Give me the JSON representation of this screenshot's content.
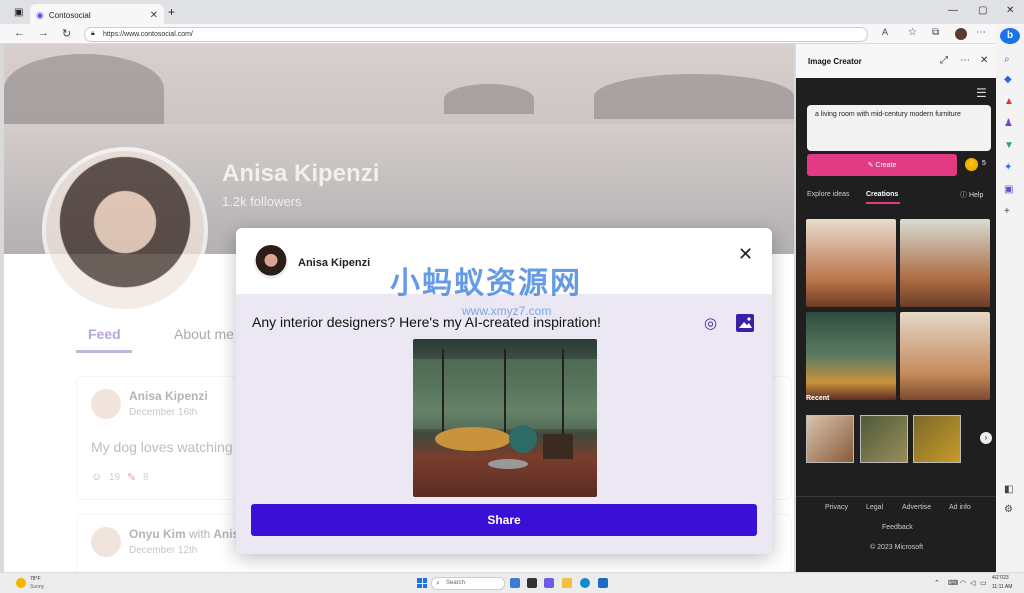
{
  "browser": {
    "tab_title": "Contosocial",
    "url": "https://www.contosocial.com/"
  },
  "profile": {
    "name": "Anisa Kipenzi",
    "followers": "1.2k followers",
    "tabs": [
      "Feed",
      "About me"
    ]
  },
  "posts": [
    {
      "author": "Anisa Kipenzi",
      "date": "December 16th",
      "text": "My dog loves watching",
      "likes": "19",
      "comments": "8"
    },
    {
      "author": "Onyu Kim",
      "with_text": "with",
      "tagged": "Anisa",
      "date": "December 12th"
    }
  ],
  "modal": {
    "author": "Anisa Kipenzi",
    "text": "Any interior designers? Here's my AI-created inspiration!",
    "share_label": "Share"
  },
  "watermark": {
    "main": "小蚂蚁资源网",
    "sub": "www.xmyz7.com"
  },
  "image_creator": {
    "title": "Image Creator",
    "prompt": "a living room with mid-century modern furniture",
    "create_label": "Create",
    "coins": "5",
    "tabs": {
      "explore": "Explore ideas",
      "creations": "Creations"
    },
    "help": "Help",
    "recent_label": "Recent",
    "footer": {
      "privacy": "Privacy",
      "legal": "Legal",
      "advertise": "Advertise",
      "adinfo": "Ad info",
      "feedback": "Feedback",
      "copyright": "© 2023 Microsoft"
    }
  },
  "taskbar": {
    "weather_temp": "78°F",
    "weather_desc": "Sunny",
    "search_placeholder": "Search",
    "date": "4/27/23",
    "time": "11:11 AM"
  },
  "colors": {
    "accent": "#3b10d6",
    "create": "#e23b83",
    "panel_bg": "#1f1f1f"
  }
}
